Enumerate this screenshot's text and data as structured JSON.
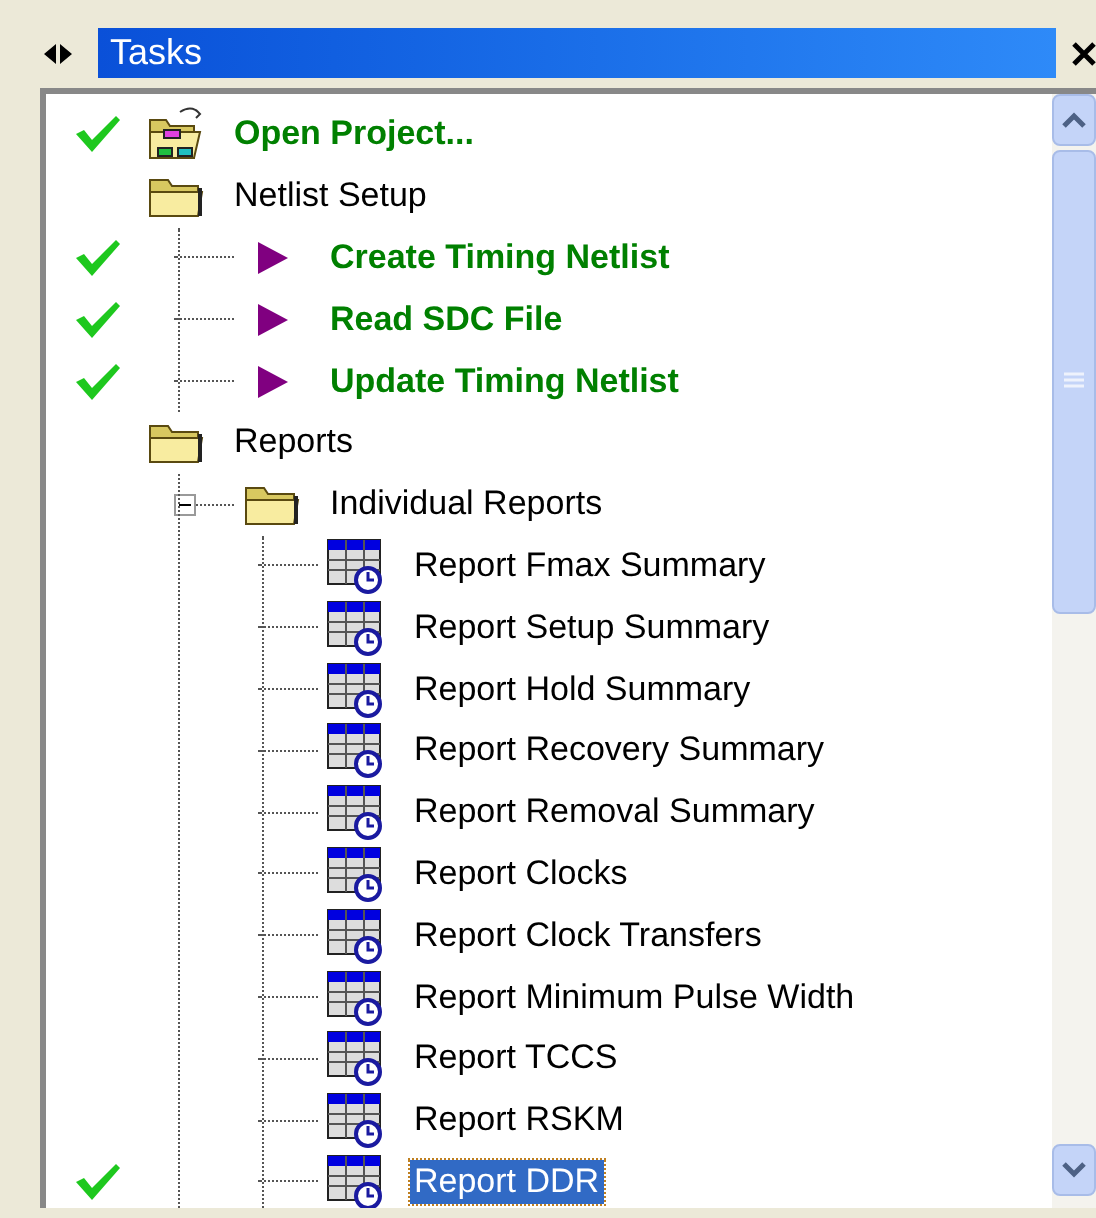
{
  "panel": {
    "title": "Tasks"
  },
  "tree": [
    {
      "kind": "task",
      "label": "Open Project...",
      "done": true,
      "selected": false
    },
    {
      "kind": "folder",
      "label": "Netlist Setup",
      "done": false,
      "selected": false,
      "children": [
        {
          "kind": "step",
          "label": "Create Timing Netlist",
          "done": true,
          "selected": false
        },
        {
          "kind": "step",
          "label": "Read SDC File",
          "done": true,
          "selected": false
        },
        {
          "kind": "step",
          "label": "Update Timing Netlist",
          "done": true,
          "selected": false
        }
      ]
    },
    {
      "kind": "folder",
      "label": "Reports",
      "done": false,
      "selected": false,
      "children": [
        {
          "kind": "folder",
          "label": "Individual Reports",
          "done": false,
          "selected": false,
          "expanded": true,
          "children": [
            {
              "kind": "report",
              "label": "Report Fmax Summary",
              "done": false,
              "selected": false
            },
            {
              "kind": "report",
              "label": "Report Setup Summary",
              "done": false,
              "selected": false
            },
            {
              "kind": "report",
              "label": "Report Hold Summary",
              "done": false,
              "selected": false
            },
            {
              "kind": "report",
              "label": "Report Recovery Summary",
              "done": false,
              "selected": false
            },
            {
              "kind": "report",
              "label": "Report Removal Summary",
              "done": false,
              "selected": false
            },
            {
              "kind": "report",
              "label": "Report Clocks",
              "done": false,
              "selected": false
            },
            {
              "kind": "report",
              "label": "Report Clock Transfers",
              "done": false,
              "selected": false
            },
            {
              "kind": "report",
              "label": "Report Minimum Pulse Width",
              "done": false,
              "selected": false
            },
            {
              "kind": "report",
              "label": "Report TCCS",
              "done": false,
              "selected": false
            },
            {
              "kind": "report",
              "label": "Report RSKM",
              "done": false,
              "selected": false
            },
            {
              "kind": "report",
              "label": "Report DDR",
              "done": true,
              "selected": true
            }
          ]
        }
      ]
    }
  ]
}
